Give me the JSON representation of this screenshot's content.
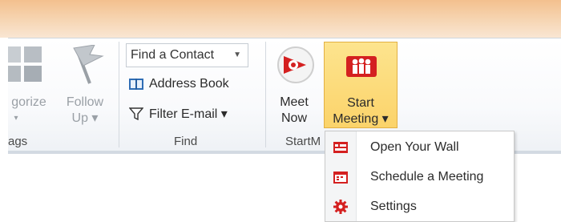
{
  "ribbon": {
    "groups": {
      "tags_label": "ags",
      "find_label": "Find",
      "start_label": "StartM"
    },
    "categorize": {
      "label_line1": "gorize",
      "label_line2": "▾"
    },
    "follow_up": {
      "label_line1": "Follow",
      "label_line2": "Up ▾"
    },
    "find": {
      "find_contact_placeholder": "Find a Contact",
      "address_book_label": "Address Book",
      "filter_email_label": "Filter E-mail ▾"
    },
    "meet_now": {
      "line1": "Meet",
      "line2": "Now"
    },
    "start_meeting": {
      "line1": "Start",
      "line2": "Meeting ▾"
    }
  },
  "dropdown_menu": {
    "items": [
      {
        "label": "Open Your Wall",
        "icon": "wall-icon"
      },
      {
        "label": "Schedule a Meeting",
        "icon": "calendar-icon"
      },
      {
        "label": "Settings",
        "icon": "gear-icon"
      }
    ]
  },
  "colors": {
    "accent_red": "#d42020",
    "button_highlight": "#fbd36a"
  }
}
